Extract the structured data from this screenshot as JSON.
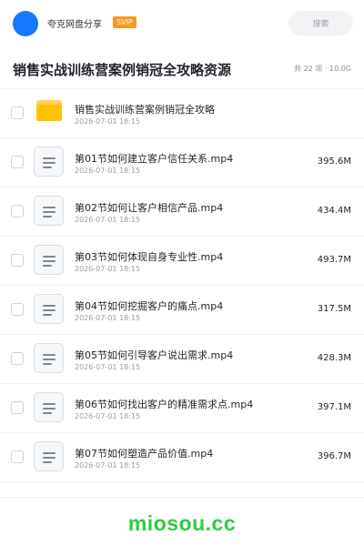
{
  "header": {
    "app_name": "夸克网盘分享",
    "badge": "SVIP",
    "search_placeholder": "搜索"
  },
  "title": {
    "text": "销售实战训练营案例销冠全攻略资源",
    "meta": "共 22 项 · 10.0G"
  },
  "files": [
    {
      "type": "folder",
      "name": "销售实战训练营案例销冠全攻略",
      "date": "2026-07-01 18:15",
      "size": ""
    },
    {
      "type": "file",
      "name": "第01节如何建立客户信任关系.mp4",
      "date": "2026-07-01 18:15",
      "size": "395.6M"
    },
    {
      "type": "file",
      "name": "第02节如何让客户相信产品.mp4",
      "date": "2026-07-01 18:15",
      "size": "434.4M"
    },
    {
      "type": "file",
      "name": "第03节如何体现自身专业性.mp4",
      "date": "2026-07-01 18:15",
      "size": "493.7M"
    },
    {
      "type": "file",
      "name": "第04节如何挖掘客户的痛点.mp4",
      "date": "2026-07-01 18:15",
      "size": "317.5M"
    },
    {
      "type": "file",
      "name": "第05节如何引导客户说出需求.mp4",
      "date": "2026-07-01 18:15",
      "size": "428.3M"
    },
    {
      "type": "file",
      "name": "第06节如何找出客户的精准需求点.mp4",
      "date": "2026-07-01 18:15",
      "size": "397.1M"
    },
    {
      "type": "file",
      "name": "第07节如何塑造产品价值.mp4",
      "date": "2026-07-01 18:15",
      "size": "396.7M"
    }
  ],
  "footer": {
    "watermark": "miosou.cc"
  },
  "colors": {
    "accent": "#1677ff",
    "badge": "#f59a23",
    "folder": "#ffc300",
    "watermark": "#2ecc40"
  }
}
